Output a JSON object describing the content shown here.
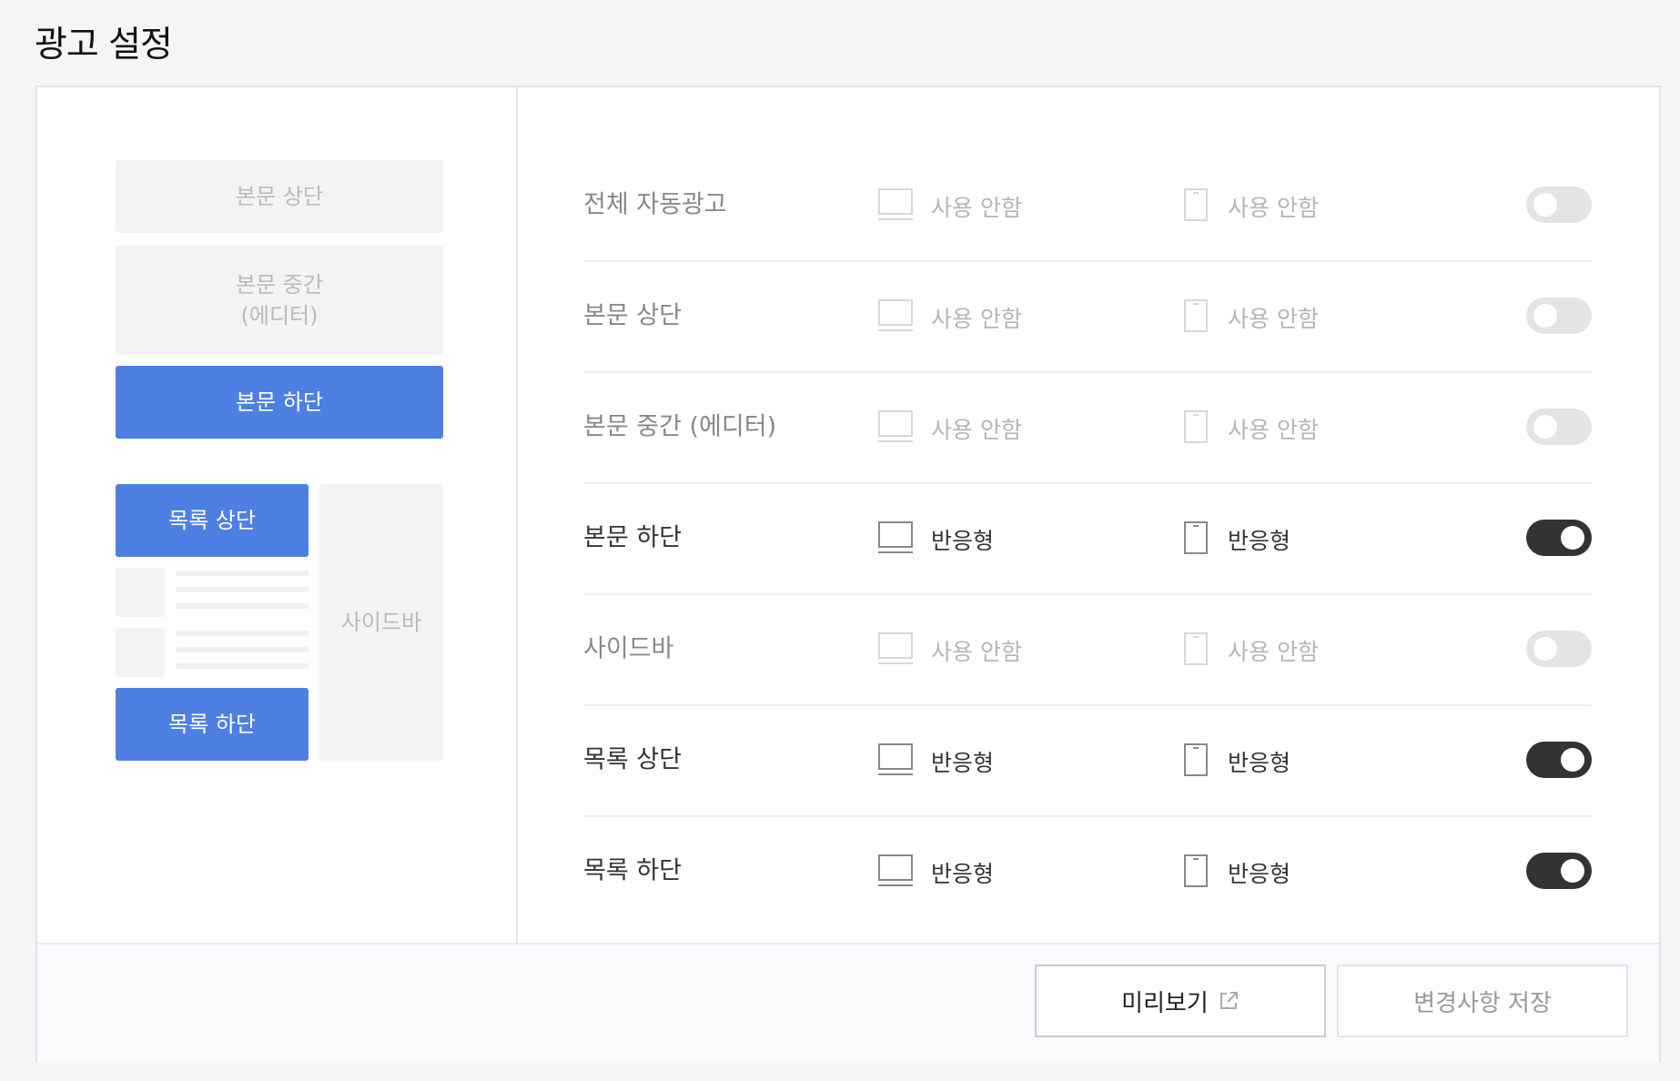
{
  "page": {
    "title": "광고 설정"
  },
  "map": {
    "body_top": "본문 상단",
    "body_middle_line1": "본문 중간",
    "body_middle_line2": "(에디터)",
    "body_bottom": "본문 하단",
    "list_top": "목록 상단",
    "list_bottom": "목록 하단",
    "sidebar": "사이드바"
  },
  "rows": [
    {
      "label": "전체 자동광고",
      "desktop": "사용 안함",
      "mobile": "사용 안함",
      "enabled": false
    },
    {
      "label": "본문 상단",
      "desktop": "사용 안함",
      "mobile": "사용 안함",
      "enabled": false
    },
    {
      "label": "본문 중간 (에디터)",
      "desktop": "사용 안함",
      "mobile": "사용 안함",
      "enabled": false
    },
    {
      "label": "본문 하단",
      "desktop": "반응형",
      "mobile": "반응형",
      "enabled": true
    },
    {
      "label": "사이드바",
      "desktop": "사용 안함",
      "mobile": "사용 안함",
      "enabled": false
    },
    {
      "label": "목록 상단",
      "desktop": "반응형",
      "mobile": "반응형",
      "enabled": true
    },
    {
      "label": "목록 하단",
      "desktop": "반응형",
      "mobile": "반응형",
      "enabled": true
    }
  ],
  "footer": {
    "preview_label": "미리보기",
    "save_label": "변경사항 저장"
  },
  "colors": {
    "accent": "#4e7fe3",
    "toggle_on": "#333333",
    "toggle_off": "#e4e4e4"
  },
  "icons": {
    "desktop": "monitor-icon",
    "mobile": "smartphone-icon",
    "external": "external-link-icon"
  }
}
